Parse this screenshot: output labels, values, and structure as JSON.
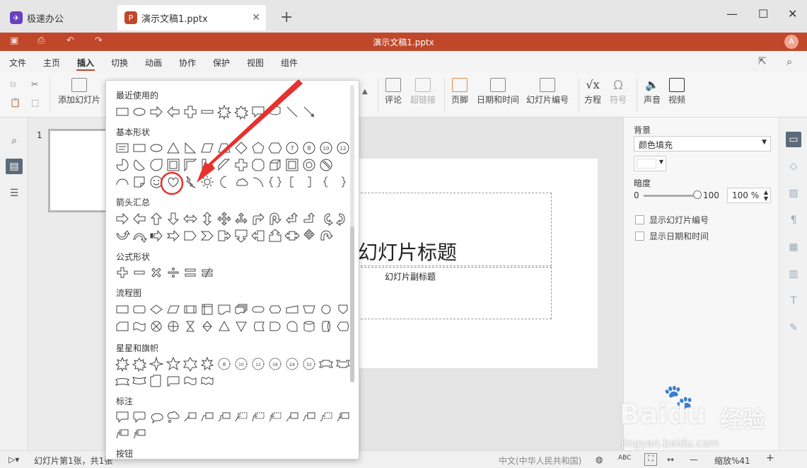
{
  "tabs": [
    {
      "label": "极速办公",
      "icon_color": "#6a3fbd"
    },
    {
      "label": "演示文稿1.pptx",
      "icon_color": "#c1472a"
    }
  ],
  "window": {
    "title": "演示文稿1.pptx",
    "avatar": "A"
  },
  "menu": [
    "文件",
    "主页",
    "插入",
    "切换",
    "动画",
    "协作",
    "保护",
    "视图",
    "组件"
  ],
  "ribbon": {
    "add_slide": "添加幻灯片",
    "comment": "评论",
    "hyperlink": "超链接",
    "footer": "页脚",
    "datetime": "日期和时间",
    "slide_number": "幻灯片编号",
    "equation": "方程",
    "symbol": "符号",
    "sound": "声音",
    "video": "视频"
  },
  "shapes_menu": {
    "sections": [
      "最近使用的",
      "基本形状",
      "箭头汇总",
      "公式形状",
      "流程图",
      "星星和旗帜",
      "标注",
      "按钮"
    ],
    "badges": [
      "7",
      "8",
      "10",
      "12"
    ],
    "star_points": [
      "8",
      "10",
      "12",
      "16",
      "24",
      "32"
    ]
  },
  "thumb_number": "1",
  "slide": {
    "title": "幻灯片标题",
    "subtitle": "幻灯片副标题"
  },
  "panel": {
    "background_label": "背景",
    "fill_type": "颜色填充",
    "darkness_label": "暗度",
    "slider_min": "0",
    "slider_max": "100",
    "slider_value": "100 %",
    "show_slide_number": "显示幻灯片编号",
    "show_datetime": "显示日期和时间"
  },
  "status": {
    "slide_info": "幻灯片第1张，共1张",
    "language": "中文(中华人民共和国)",
    "zoom": "缩放%41"
  },
  "watermark": {
    "brand": "Baidu",
    "brand2": "经验",
    "url": "jingyan.baidu.com"
  },
  "colors": {
    "accent": "#c1472a",
    "annotation": "#e8302c"
  }
}
